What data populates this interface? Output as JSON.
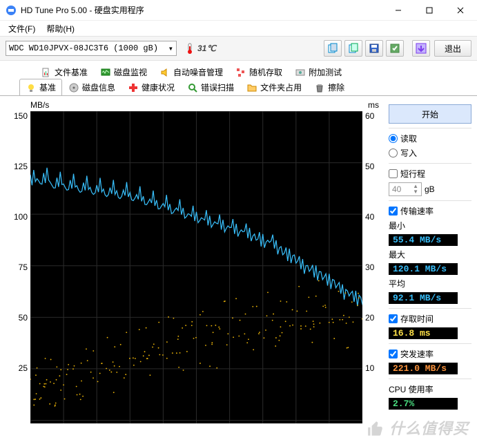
{
  "window": {
    "title": "HD Tune Pro 5.00 - 硬盘实用程序"
  },
  "menu": {
    "file": "文件(F)",
    "help": "帮助(H)"
  },
  "toolbar": {
    "drive": "WDC WD10JPVX-08JC3T6 (1000 gB)",
    "temperature": "31℃",
    "exit": "退出"
  },
  "tabs_top": {
    "file_benchmark": "文件基准",
    "disk_monitor": "磁盘监视",
    "aam": "自动噪音管理",
    "random_access": "随机存取",
    "extra_tests": "附加测试"
  },
  "tabs_bottom": {
    "benchmark": "基准",
    "info": "磁盘信息",
    "health": "健康状况",
    "error_scan": "错误扫描",
    "folder_usage": "文件夹占用",
    "erase": "擦除"
  },
  "chart": {
    "y_left_label": "MB/s",
    "y_right_label": "ms",
    "y_left_ticks": [
      "150",
      "125",
      "100",
      "75",
      "50",
      "25"
    ],
    "y_right_ticks": [
      "60",
      "50",
      "40",
      "30",
      "20",
      "10"
    ]
  },
  "side": {
    "start": "开始",
    "read": "读取",
    "write": "写入",
    "short_stroke": "短行程",
    "short_stroke_val": "40",
    "short_stroke_unit": "gB",
    "transfer_rate": "传输速率",
    "min_label": "最小",
    "min_val": "55.4 MB/s",
    "max_label": "最大",
    "max_val": "120.1 MB/s",
    "avg_label": "平均",
    "avg_val": "92.1 MB/s",
    "access_time": "存取时间",
    "access_val": "16.8 ms",
    "burst_rate": "突发速率",
    "burst_val": "221.0 MB/s",
    "cpu_usage": "CPU 使用率",
    "cpu_val": "2.7%"
  },
  "watermark": "什么值得买",
  "chart_data": {
    "type": "line",
    "title": "",
    "xlabel": "",
    "y_left": {
      "label": "MB/s",
      "range": [
        0,
        150
      ]
    },
    "y_right": {
      "label": "ms",
      "range": [
        0,
        60
      ]
    },
    "series": [
      {
        "name": "Transfer rate (MB/s)",
        "axis": "left",
        "color": "#38bdf8",
        "x": [
          0,
          2,
          4,
          6,
          8,
          10,
          12,
          14,
          16,
          18,
          20,
          22,
          24,
          26,
          28,
          30,
          32,
          34,
          36,
          38,
          40,
          42,
          44,
          46,
          48,
          50,
          52,
          54,
          56,
          58,
          60,
          62,
          64,
          66,
          68,
          70,
          72,
          74,
          76,
          78,
          80,
          82,
          84,
          86,
          88,
          90,
          92,
          94,
          96,
          98,
          100
        ],
        "values": [
          118,
          116,
          119,
          114,
          117,
          113,
          116,
          112,
          115,
          111,
          114,
          110,
          113,
          109,
          112,
          108,
          110,
          106,
          108,
          104,
          106,
          102,
          104,
          100,
          101,
          98,
          99,
          96,
          97,
          94,
          95,
          92,
          93,
          90,
          89,
          87,
          88,
          84,
          82,
          80,
          78,
          75,
          74,
          72,
          70,
          68,
          66,
          63,
          62,
          60,
          58
        ]
      },
      {
        "name": "Access time (ms)",
        "axis": "right",
        "type": "scatter",
        "color": "#eab308",
        "x": [
          0,
          1,
          2,
          3,
          4,
          5,
          6,
          7,
          8,
          9,
          10,
          12,
          14,
          15,
          16,
          18,
          20,
          22,
          24,
          25,
          26,
          28,
          30,
          32,
          34,
          35,
          36,
          38,
          40,
          42,
          44,
          45,
          46,
          48,
          50,
          52,
          54,
          55,
          56,
          58,
          60,
          62,
          64,
          66,
          68,
          70,
          72,
          74,
          75,
          76,
          78,
          80,
          82,
          84,
          85,
          86,
          88,
          90,
          92,
          94,
          95,
          96,
          98,
          100
        ],
        "values": [
          6,
          5,
          7,
          9,
          6,
          10,
          8,
          6,
          5,
          9,
          7,
          11,
          8,
          6,
          10,
          12,
          9,
          14,
          11,
          8,
          13,
          10,
          15,
          12,
          16,
          11,
          14,
          17,
          13,
          18,
          15,
          12,
          16,
          19,
          14,
          20,
          17,
          13,
          18,
          21,
          16,
          22,
          19,
          15,
          20,
          17,
          23,
          18,
          16,
          21,
          19,
          24,
          20,
          17,
          22,
          19,
          25,
          21,
          18,
          23,
          20,
          17,
          24,
          22
        ]
      }
    ]
  }
}
